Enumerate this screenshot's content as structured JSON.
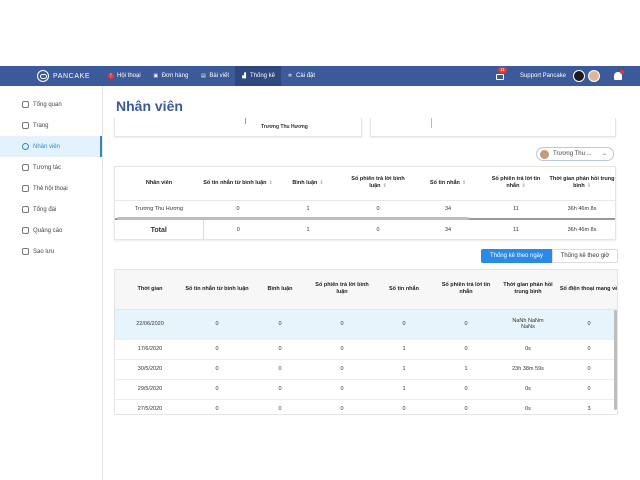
{
  "brand": {
    "name": "PANCAKE"
  },
  "nav": {
    "items": [
      {
        "label": "Hội thoại",
        "icon": "alert-circle-icon"
      },
      {
        "label": "Đơn hàng",
        "icon": "cart-icon"
      },
      {
        "label": "Bài viết",
        "icon": "article-icon"
      },
      {
        "label": "Thống kê",
        "icon": "chart-icon",
        "active": true
      },
      {
        "label": "Cài đặt",
        "icon": "gear-icon"
      }
    ],
    "notify_badge": "11",
    "support_label": "Support Pancake"
  },
  "sidebar": {
    "items": [
      {
        "label": "Tổng quan",
        "icon": "dashboard-icon"
      },
      {
        "label": "Trang",
        "icon": "flag-icon"
      },
      {
        "label": "Nhân viên",
        "icon": "user-icon",
        "active": true
      },
      {
        "label": "Tương tác",
        "icon": "interaction-icon"
      },
      {
        "label": "Thẻ hội thoại",
        "icon": "tag-icon"
      },
      {
        "label": "Tổng đài",
        "icon": "phone-icon"
      },
      {
        "label": "Quảng cáo",
        "icon": "ads-icon"
      },
      {
        "label": "Sao lưu",
        "icon": "backup-icon"
      }
    ]
  },
  "page": {
    "title": "Nhân viên"
  },
  "chart_card": {
    "label": "Trương Thu Hương"
  },
  "selector": {
    "value": "Trương Thu ..."
  },
  "staff_table": {
    "headers": [
      "Nhân viên",
      "Số tin nhắn từ bình luận",
      "Bình luận",
      "Số phiên trả lời bình luận",
      "Số tin nhắn",
      "Số phiên trả lời tin nhắn",
      "Thời gian phản hồi trung bình"
    ],
    "rows": [
      [
        "Trương Thu Hương",
        "0",
        "1",
        "0",
        "34",
        "11",
        "36h 46m 8s"
      ]
    ],
    "total": [
      "Total",
      "0",
      "1",
      "0",
      "34",
      "11",
      "36h 46m 8s"
    ]
  },
  "buttons": {
    "by_day": "Thống kê theo ngày",
    "by_hour": "Thống kê theo giờ"
  },
  "daily_table": {
    "headers": [
      "Thời gian",
      "Số tin nhắn từ bình luận",
      "Bình luận",
      "Số phiên trả lời bình luận",
      "Số tin nhắn",
      "Số phiên trả lời tin nhắn",
      "Thời gian phản hồi trung bình",
      "Số điện thoại mang về"
    ],
    "rows": [
      [
        "22/06/2020",
        "0",
        "0",
        "0",
        "0",
        "0",
        "NaNh NaNm NaNs",
        "0"
      ],
      [
        "17/6/2020",
        "0",
        "0",
        "0",
        "1",
        "0",
        "0s",
        "0"
      ],
      [
        "30/5/2020",
        "0",
        "0",
        "0",
        "1",
        "1",
        "23h 38m 59s",
        "0"
      ],
      [
        "29/5/2020",
        "0",
        "0",
        "0",
        "1",
        "0",
        "0s",
        "0"
      ],
      [
        "27/5/2020",
        "0",
        "0",
        "0",
        "0",
        "0",
        "0s",
        "3"
      ]
    ]
  },
  "colors": {
    "topbar": "#3c5a9a",
    "accent": "#2b89e8",
    "badge": "#e53935"
  }
}
